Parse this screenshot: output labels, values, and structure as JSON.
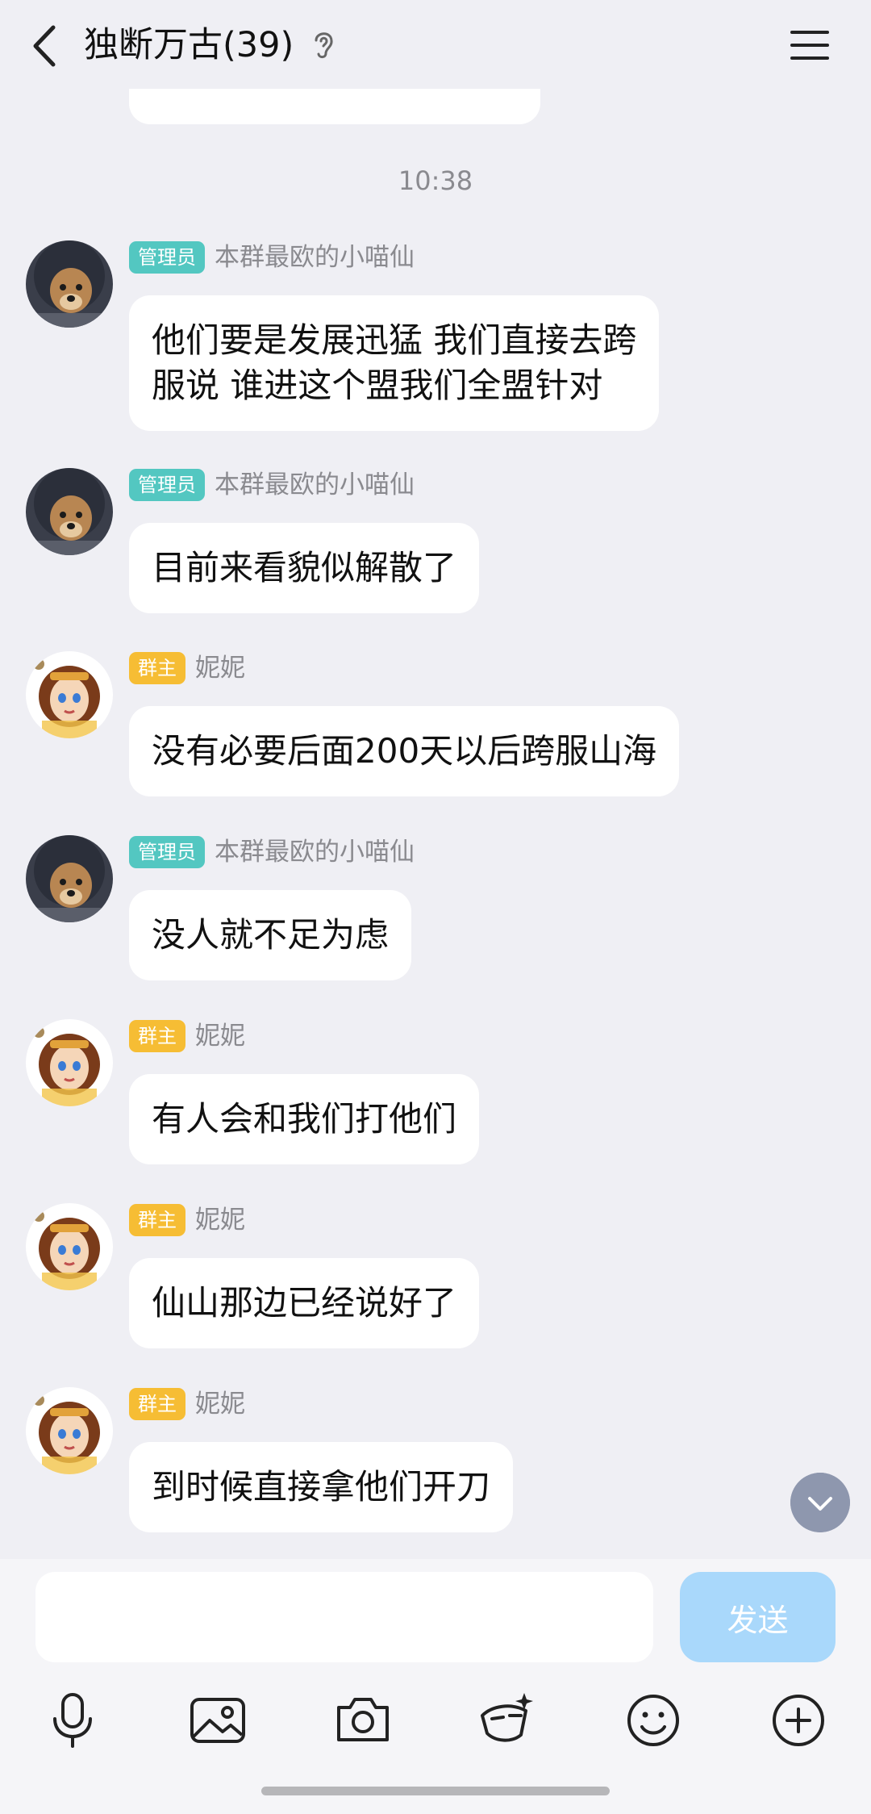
{
  "header": {
    "title": "独断万古(39)"
  },
  "timestamp": "10:38",
  "messages": [
    {
      "badge": "管理员",
      "role": "admin",
      "sender": "本群最欧的小喵仙",
      "text": "他们要是发展迅猛 我们直接去跨\n服说 谁进这个盟我们全盟针对"
    },
    {
      "badge": "管理员",
      "role": "admin",
      "sender": "本群最欧的小喵仙",
      "text": "目前来看貌似解散了"
    },
    {
      "badge": "群主",
      "role": "owner",
      "sender": "妮妮",
      "text": "没有必要后面200天以后跨服山海"
    },
    {
      "badge": "管理员",
      "role": "admin",
      "sender": "本群最欧的小喵仙",
      "text": "没人就不足为虑"
    },
    {
      "badge": "群主",
      "role": "owner",
      "sender": "妮妮",
      "text": "有人会和我们打他们"
    },
    {
      "badge": "群主",
      "role": "owner",
      "sender": "妮妮",
      "text": "仙山那边已经说好了"
    },
    {
      "badge": "群主",
      "role": "owner",
      "sender": "妮妮",
      "text": "到时候直接拿他们开刀"
    }
  ],
  "input": {
    "value": "",
    "send_label": "发送"
  },
  "toolbar": {
    "icons": [
      "microphone-icon",
      "image-icon",
      "camera-icon",
      "red-packet-icon",
      "emoji-icon",
      "plus-icon"
    ]
  },
  "colors": {
    "background": "#efeff4",
    "admin_badge": "#53c7c1",
    "owner_badge": "#f6bd34",
    "send_button": "#a9d8fb"
  }
}
